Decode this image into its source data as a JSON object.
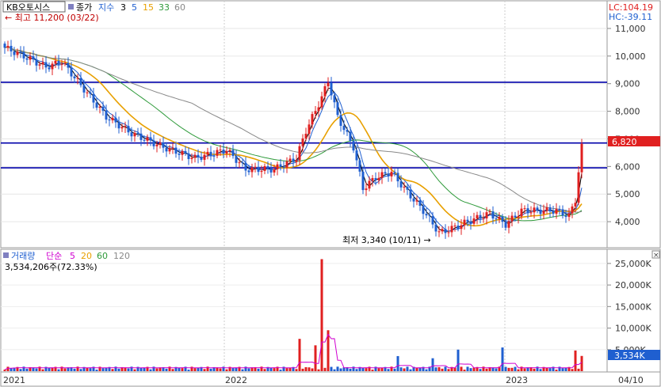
{
  "header": {
    "symbol": "KB오토시스",
    "price_label": "종가",
    "ma_label": "지수",
    "ma_periods": [
      "3",
      "5",
      "15",
      "33",
      "60"
    ],
    "high_note": "← 최고 11,200 (03/22)",
    "lc_text": "LC:104.19",
    "hc_text": "HC:-39.11"
  },
  "price_axis": {
    "ticks": [
      "11,000",
      "10,000",
      "9,000",
      "8,000",
      "7,000",
      "6,000",
      "5,000",
      "4,000"
    ],
    "current_price": "6,820"
  },
  "low_note": "최저 3,340 (10/11) →",
  "volume_header": {
    "title": "거래량",
    "ma_label": "단순",
    "ma_periods": [
      "5",
      "20",
      "60",
      "120"
    ],
    "current_text": "3,534,206주(72.33%)"
  },
  "volume_axis": {
    "ticks": [
      "25,000K",
      "20,000K",
      "15,000K",
      "10,000K",
      "5,000K"
    ],
    "current_volume": "3,534K"
  },
  "time_axis": {
    "labels": [
      "2021",
      "2022",
      "2023",
      "04/10"
    ]
  },
  "colors": {
    "up": "#e02020",
    "down": "#1f5fd0",
    "hline": "#0000aa",
    "ma3": "#000000",
    "ma5": "#1f5fd0",
    "ma15": "#e8a000",
    "ma33": "#2e9a3a",
    "ma60": "#888888",
    "volma5": "#d000d0"
  },
  "chart_data": {
    "type": "candlestick",
    "price_range": [
      3200,
      11400
    ],
    "horizontal_lines": [
      9050,
      6850,
      5950
    ],
    "annotations": [
      {
        "text": "최고 11,200 (03/22)",
        "value": 11200
      },
      {
        "text": "최저 3,340 (10/11)",
        "value": 3340
      }
    ],
    "volume_range": [
      0,
      27000
    ],
    "keypoints": [
      {
        "i": 0,
        "close": 10300
      },
      {
        "i": 6,
        "close": 10000
      },
      {
        "i": 13,
        "close": 9600
      },
      {
        "i": 18,
        "close": 9800
      },
      {
        "i": 25,
        "close": 8800
      },
      {
        "i": 32,
        "close": 7800
      },
      {
        "i": 40,
        "close": 7200
      },
      {
        "i": 50,
        "close": 6700
      },
      {
        "i": 60,
        "close": 6300
      },
      {
        "i": 70,
        "close": 6600
      },
      {
        "i": 76,
        "close": 5900
      },
      {
        "i": 85,
        "close": 5900
      },
      {
        "i": 92,
        "close": 6300
      },
      {
        "i": 95,
        "close": 7300
      },
      {
        "i": 100,
        "close": 8500
      },
      {
        "i": 102,
        "close": 9100
      },
      {
        "i": 105,
        "close": 7800
      },
      {
        "i": 110,
        "close": 6700
      },
      {
        "i": 113,
        "close": 5200
      },
      {
        "i": 117,
        "close": 5600
      },
      {
        "i": 122,
        "close": 5800
      },
      {
        "i": 126,
        "close": 5200
      },
      {
        "i": 132,
        "close": 4400
      },
      {
        "i": 137,
        "close": 3600
      },
      {
        "i": 140,
        "close": 3700
      },
      {
        "i": 146,
        "close": 4000
      },
      {
        "i": 153,
        "close": 4300
      },
      {
        "i": 158,
        "close": 3900
      },
      {
        "i": 163,
        "close": 4400
      },
      {
        "i": 168,
        "close": 4400
      },
      {
        "i": 174,
        "close": 4400
      },
      {
        "i": 178,
        "close": 4200
      },
      {
        "i": 180,
        "close": 4800
      },
      {
        "i": 182,
        "close": 6820
      }
    ],
    "volume_spikes": [
      {
        "i": 93,
        "value": 7500
      },
      {
        "i": 98,
        "value": 6000
      },
      {
        "i": 100,
        "value": 26000
      },
      {
        "i": 102,
        "value": 9500
      },
      {
        "i": 124,
        "value": 3500
      },
      {
        "i": 135,
        "value": 3000
      },
      {
        "i": 143,
        "value": 5000
      },
      {
        "i": 157,
        "value": 5500
      },
      {
        "i": 180,
        "value": 4800
      },
      {
        "i": 182,
        "value": 3534
      }
    ]
  }
}
